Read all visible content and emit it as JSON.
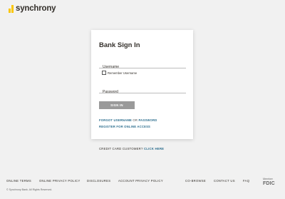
{
  "brand": {
    "name": "synchrony",
    "accent": "#fbc600"
  },
  "login": {
    "title": "Bank Sign In",
    "username_placeholder": "Username",
    "remember_label": "Remember Username",
    "password_placeholder": "Password",
    "signin_label": "SIGN IN",
    "forgot_prefix": "FORGOT ",
    "forgot_username": "USERNAME",
    "forgot_or": " OR ",
    "forgot_password": "PASSWORD",
    "register_label": "REGISTER FOR ONLINE ACCESS"
  },
  "credit_card": {
    "prompt": "CREDIT CARD CUSTOMER? ",
    "link": "CLICK HERE"
  },
  "footer": {
    "links": [
      "ONLINE TERMS",
      "ONLINE PRIVACY POLICY",
      "DISCLOSURES",
      "ACCOUNT PRIVACY POLICY",
      "CO-BROWSE",
      "CONTACT US",
      "FAQ"
    ],
    "copyright": "© Synchrony Bank. All Rights Reserved.",
    "fdic_top": "Member",
    "fdic_bottom": "FDIC"
  },
  "colors": {
    "link": "#2c6e8e",
    "button": "#9a9a9a",
    "background": "#f1f1f1"
  }
}
